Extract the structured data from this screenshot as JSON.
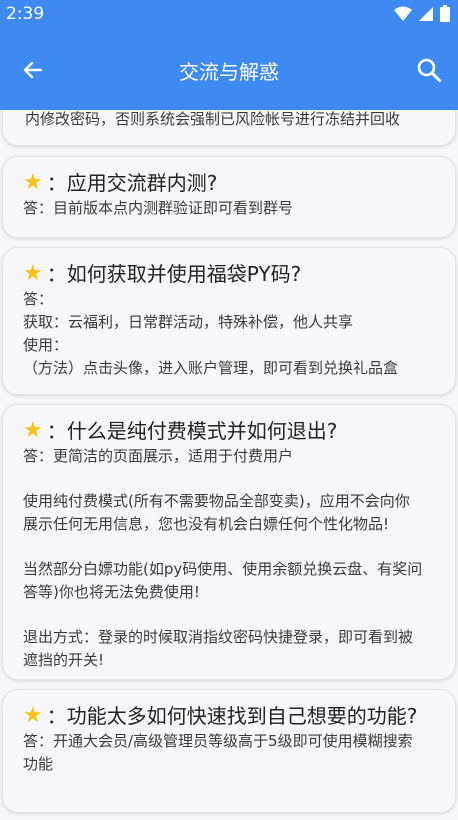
{
  "status": {
    "time": "2:39"
  },
  "appbar": {
    "title": "交流与解惑"
  },
  "top_partial": "内修改密码，否则系统会强制已风险帐号进行冻结并回收",
  "cards": [
    {
      "question": "：应用交流群内测?",
      "lines": [
        "答：目前版本点内测群验证即可看到群号"
      ]
    },
    {
      "question": "：如何获取并使用福袋PY码?",
      "lines": [
        "答：",
        "获取：云福利，日常群活动，特殊补偿，他人共享",
        "使用：",
        "（方法）点击头像，进入账户管理，即可看到兑换礼品盒"
      ]
    },
    {
      "question": "：什么是纯付费模式并如何退出?",
      "lines": [
        "答：更简洁的页面展示，适用于付费用户",
        "",
        "使用纯付费模式(所有不需要物品全部变卖)，应用不会向你",
        "展示任何无用信息，您也没有机会白嫖任何个性化物品!",
        "",
        "当然部分白嫖功能(如py码使用、使用余额兑换云盘、有奖问",
        "答等)你也将无法免费使用!",
        "",
        "退出方式：登录的时候取消指纹密码快捷登录，即可看到被",
        "遮挡的开关!"
      ]
    },
    {
      "question": "：功能太多如何快速找到自己想要的功能?",
      "lines": [
        "答：开通大会员/高级管理员等级高于5级即可使用模糊搜索",
        "功能"
      ]
    }
  ]
}
